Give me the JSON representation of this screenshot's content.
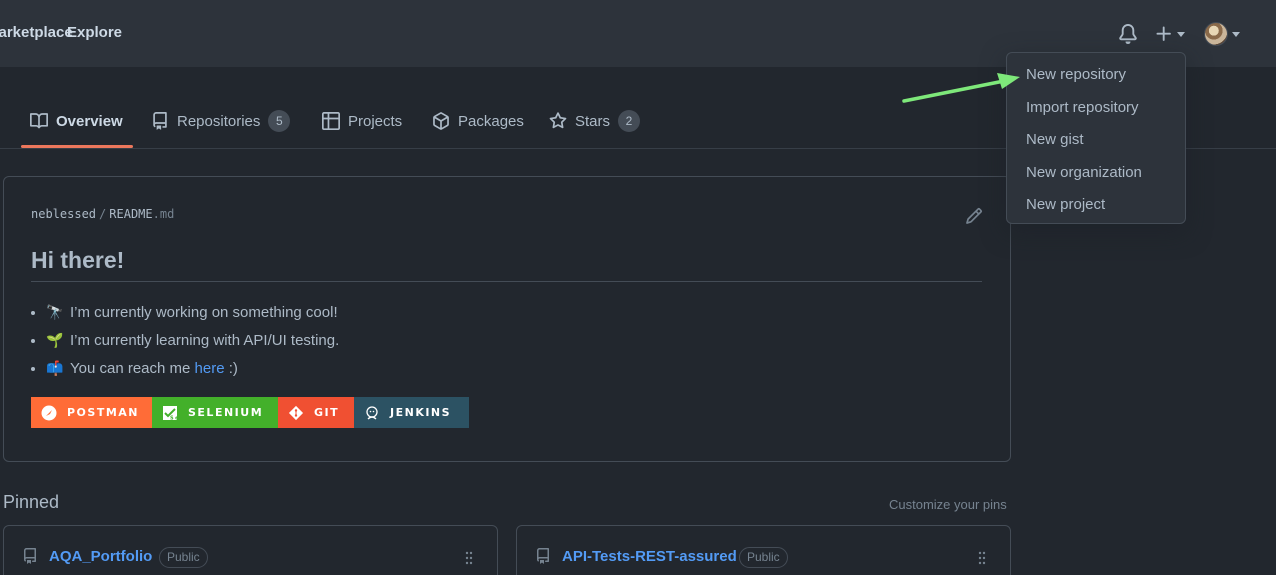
{
  "header": {
    "nav": [
      "Marketplace",
      "Explore"
    ]
  },
  "tabs": [
    {
      "label": "Overview"
    },
    {
      "label": "Repositories",
      "count": "5"
    },
    {
      "label": "Projects"
    },
    {
      "label": "Packages"
    },
    {
      "label": "Stars",
      "count": "2"
    }
  ],
  "readme": {
    "owner": "neblessed",
    "file": "README",
    "ext": ".md",
    "title": "Hi there!",
    "items": [
      {
        "emoji": "🔭",
        "text": "I’m currently working on something cool!"
      },
      {
        "emoji": "🌱",
        "text": "I’m currently learning with API/UI testing."
      },
      {
        "emoji": "📫",
        "text": "You can reach me ",
        "link": "here",
        "suffix": " :)"
      }
    ],
    "badges": [
      "POSTMAN",
      "SELENIUM",
      "GIT",
      "JENKINS"
    ]
  },
  "pinned": {
    "title": "Pinned",
    "customize": "Customize your pins",
    "repos": [
      {
        "name": "AQA_Portfolio",
        "visibility": "Public"
      },
      {
        "name": "API-Tests-REST-assured",
        "visibility": "Public"
      }
    ]
  },
  "dropdown": {
    "items": [
      "New repository",
      "Import repository",
      "New gist",
      "New organization",
      "New project"
    ]
  },
  "colors": {
    "background": "#22272e",
    "header": "#2d333b",
    "accent_underline": "#ec775c",
    "link": "#539bf5",
    "annotation_arrow": "#7ee87a"
  }
}
